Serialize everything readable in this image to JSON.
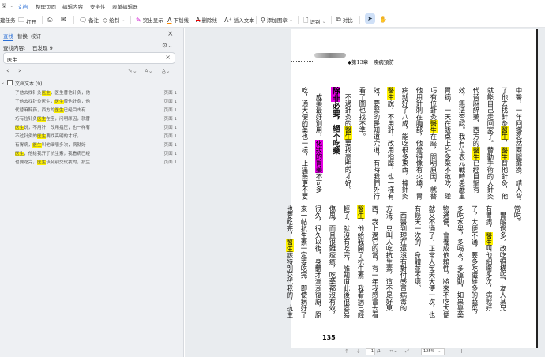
{
  "menu": {
    "items": [
      "文档",
      "整理页面",
      "编辑内容",
      "安全性",
      "表单编辑器"
    ],
    "active": "文档"
  },
  "toolbar": {
    "new_task": "建任务",
    "open": "打开",
    "note": "备注",
    "draw": "绘制",
    "highlight": "突出显示",
    "underline": "下划线",
    "strikethrough": "删除线",
    "insert_text": "插入文本",
    "add_stamp": "添加图章",
    "recognize": "识别",
    "compare": "对比"
  },
  "panel": {
    "tabs": [
      "查找",
      "替换",
      "校订"
    ],
    "find_label": "查找内容:",
    "found": "已发现 9",
    "search_value": "医生",
    "group_label": "文档文本 (9)",
    "results": [
      {
        "pre": "了他去找针灸",
        "hit": "医生",
        "post": "，医生替他针灸，他",
        "page": "页面 1"
      },
      {
        "pre": "了他去找针灸医生，",
        "hit": "医生",
        "post": "替他针灸，他",
        "page": "页面 1"
      },
      {
        "pre": "代替麻醉药，西方的",
        "hit": "医生",
        "post": "已经目击有",
        "page": "页面 1"
      },
      {
        "pre": "巧有位针灸",
        "hit": "医生",
        "post": "在座，问明原因，就替",
        "page": "页面 1"
      },
      {
        "pre": "",
        "hit": "医生",
        "post": "说，不用针，改用指压，也一样有",
        "page": "页面 1"
      },
      {
        "pre": "不过针灸的",
        "hit": "医生",
        "post": "要找高明的才好。",
        "page": "页面 1"
      },
      {
        "pre": "有胃病，",
        "hit": "医生",
        "post": "叫他细嚼多次，病就好",
        "page": "页面 1"
      },
      {
        "pre": "",
        "hit": "医生",
        "post": "，他给我开了抗生素，我看病已经",
        "page": "页面 1"
      },
      {
        "pre": "也要吃完，",
        "hit": "医生",
        "post": "该特别交代我的，抗生",
        "page": "页面 1"
      }
    ]
  },
  "document": {
    "header": "◆第13章　疾病預防",
    "top_columns": [
      "中醫，一年回鄉忽然兩腿癱瘓，請人背",
      "了他去找針灸醫生，醫生替他針灸，他",
      "就能自己走回家了。替動手術的人針灸",
      "代替麻醉藥，西方的醫生已經目擊有",
      "效，無法否認。我有位表兄戰時患嚴重",
      "胃病，一天在飯桌上許多菜不敢吃，碰",
      "巧有位針灸醫生在座，問明原因，就替",
      "他用針刺在胸部，他覺得像有火燒，胃",
      "病就好了八成，能吃很多東西。據針灸",
      "醫生說，不用針，改用指壓，也一樣有",
      "效，要緊的是知道穴道，有時我們外行",
      "看了圖也找不準。",
      "　不過針灸的醫生要找高明的才好。"
    ],
    "heading_mark": "除非",
    "heading_rest": "必要，絕不吃藥",
    "after_heading": [
      {
        "pre": "　成藥最好別用，",
        "mark": "化妝的胃藥",
        "post": "不可多"
      },
      {
        "pre": "吃，通大便的藥也一樣，止痛藥更不要",
        "mark": "",
        "post": ""
      }
    ],
    "bottom_columns": [
      "常吃。",
      "　胃酸過多，改吃得橫些，友人某兄",
      "有胃病，醫生叫他細嚼多次，病就好",
      "了，大便不通，要多吃纖維多的蔬菜，",
      "多吃水果，多喝水，多運動，如果靠藥",
      "物通便，會養成依賴性，將來不吃大便",
      "就又不通了，正常人每天大便一次，也",
      "有幾天一次的，身體並不壞。",
      "　西醫到現在還沒有對付感冒病毒的",
      "方法，只叫人吃抗生素，這不是好東",
      "西，我上過它的當，有一年我感冒去看",
      "醫生，他給我開了抗生素，我看病已經",
      "輕了，就沒有吃完，誰知道此後很容易",
      "傷風，而且很難痊癒，吃藥都沒有效，",
      "很久，很久以後，身體才漸漸復原，原",
      "來一帖抗生素一定要吃完，即使病好了",
      "也要吃完，醫生該特別交代我的，抗生"
    ],
    "highlight_term": "醫生",
    "page_number": "135"
  },
  "statusbar": {
    "page_current": "1",
    "page_total": "/1",
    "zoom": "125%",
    "minus": "−",
    "plus": "+"
  },
  "colors": {
    "accent": "#2b6fd6",
    "highlight": "#fff200",
    "magenta": "#e600e6"
  }
}
